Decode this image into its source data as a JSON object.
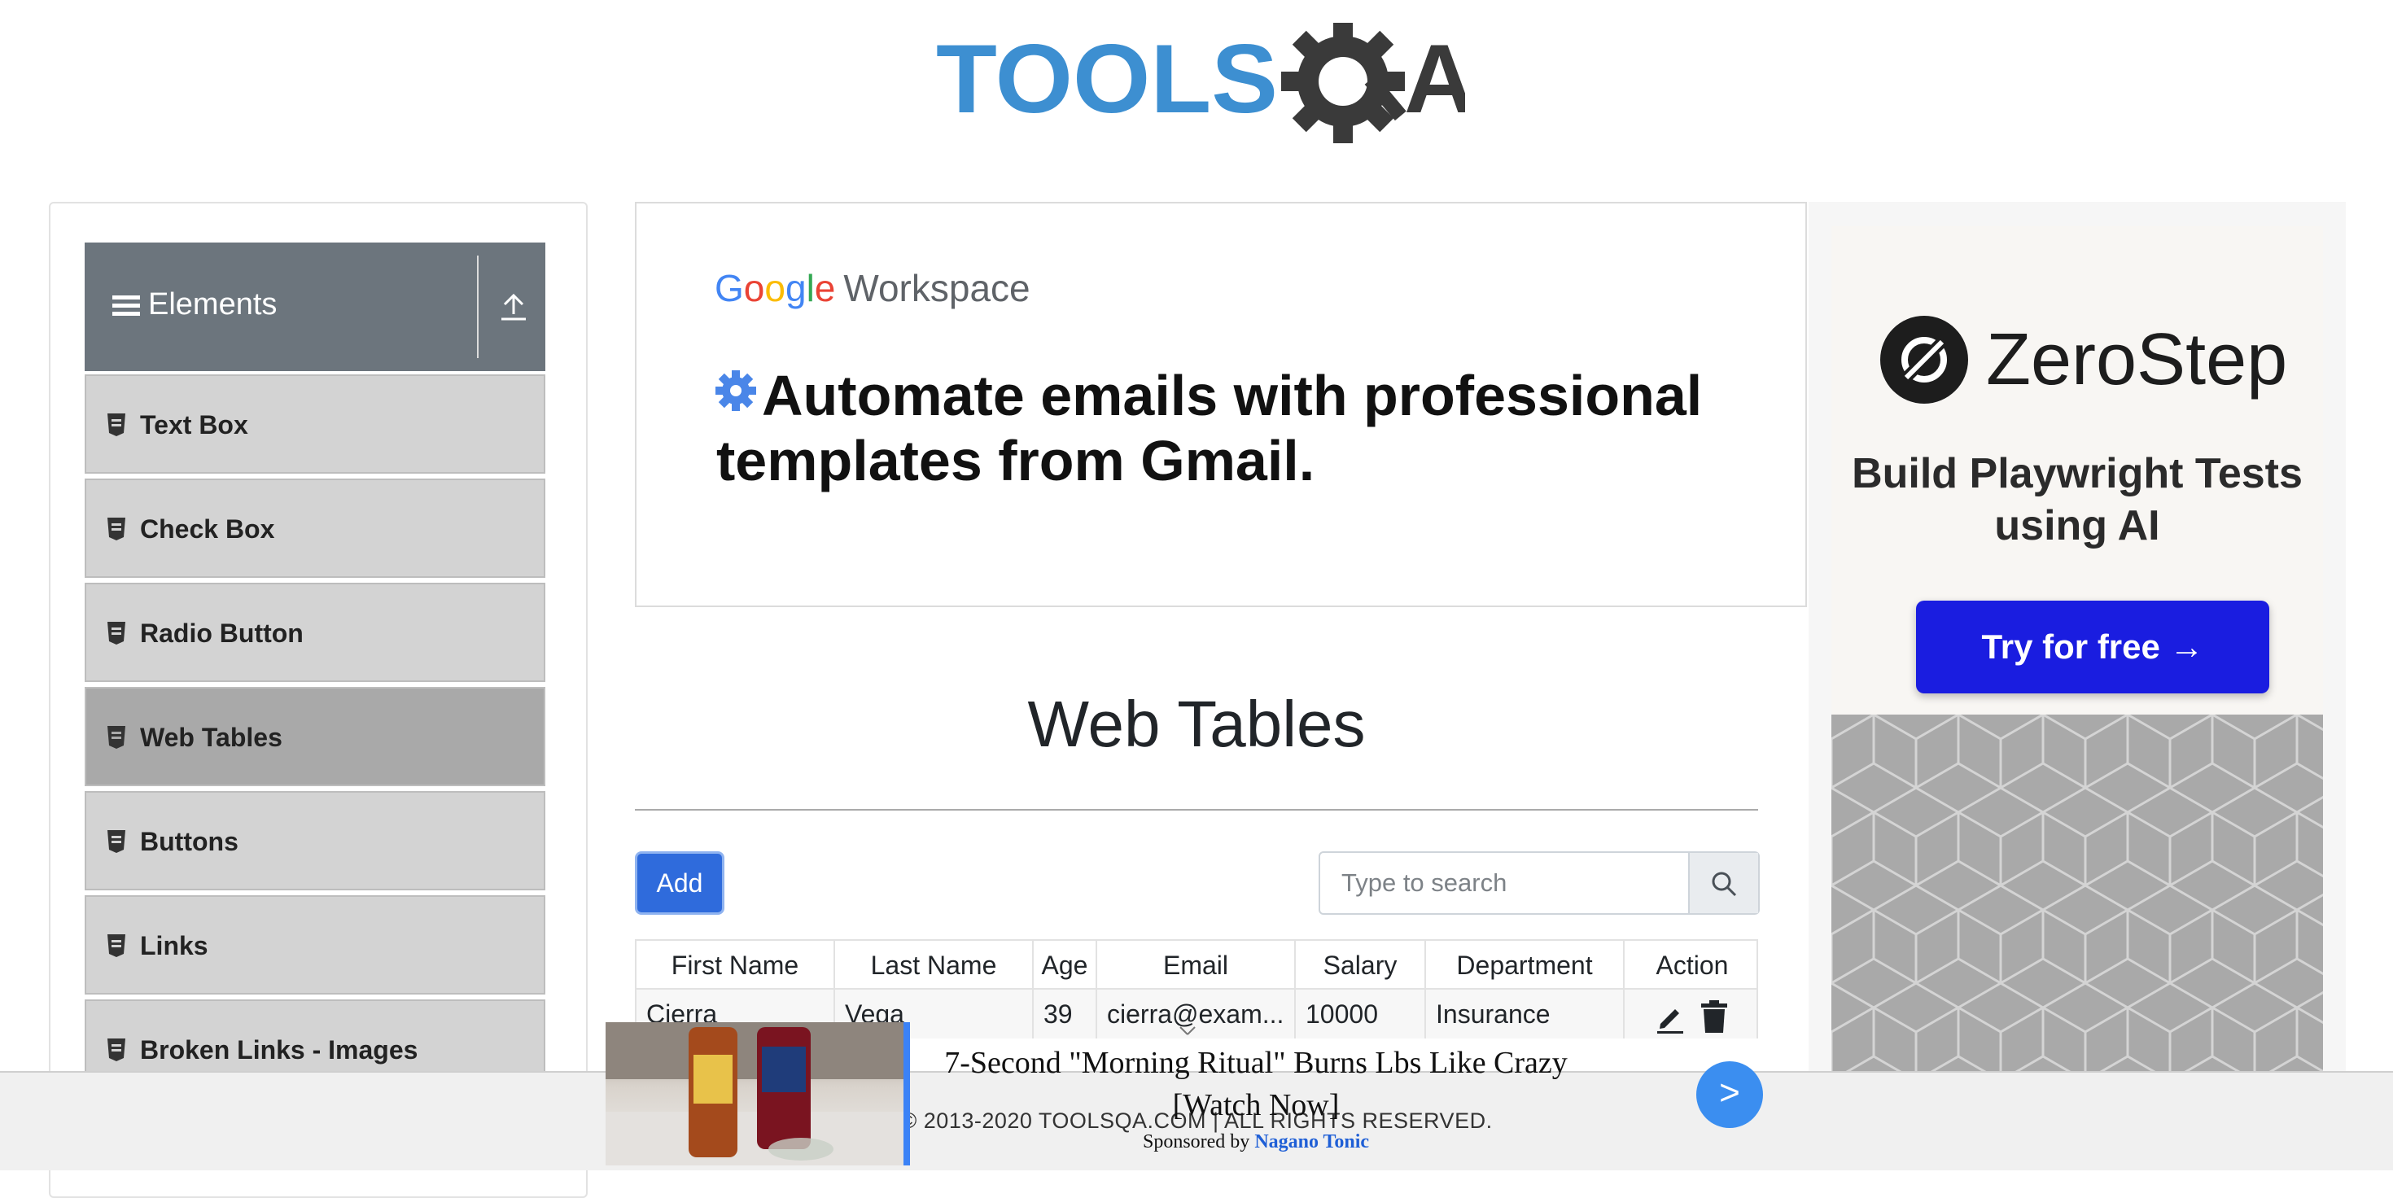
{
  "header": {
    "logo_alt": "TOOLSQA"
  },
  "sidebar": {
    "group_title": "Elements",
    "items": [
      {
        "label": "Text Box"
      },
      {
        "label": "Check Box"
      },
      {
        "label": "Radio Button"
      },
      {
        "label": "Web Tables",
        "active": true
      },
      {
        "label": "Buttons"
      },
      {
        "label": "Links"
      },
      {
        "label": "Broken Links - Images"
      }
    ]
  },
  "google_ad": {
    "brand_letters": [
      "G",
      "o",
      "o",
      "g",
      "l",
      "e"
    ],
    "product": "Workspace",
    "headline": "Automate emails with professional templates from Gmail."
  },
  "zerostep_ad": {
    "brand": "ZeroStep",
    "subtitle": "Build Playwright Tests using AI",
    "cta": "Try for free →"
  },
  "page": {
    "title": "Web Tables",
    "add_label": "Add",
    "search": {
      "placeholder": "Type to search",
      "value": ""
    }
  },
  "table": {
    "columns": [
      "First Name",
      "Last Name",
      "Age",
      "Email",
      "Salary",
      "Department",
      "Action"
    ],
    "rows": [
      {
        "first": "Cierra",
        "last": "Vega",
        "age": "39",
        "email": "cierra@exam...",
        "salary": "10000",
        "department": "Insurance"
      }
    ]
  },
  "footer": {
    "copyright": "© 2013-2020 TOOLSQA.COM | ALL RIGHTS RESERVED."
  },
  "bottom_ad": {
    "headline": "7-Second \"Morning Ritual\" Burns Lbs Like Crazy [Watch Now]",
    "sponsored_prefix": "Sponsored by",
    "sponsor": "Nagano Tonic",
    "next_glyph": ">"
  },
  "colors": {
    "sidebar_header": "#6c757d",
    "menu_item": "#d3d3d3",
    "menu_item_active": "#a9a9a9",
    "add_button": "#2f6bdc",
    "zerostep_cta": "#1a1de0",
    "logo_blue": "#3d8fd1",
    "logo_dark": "#3a3a3a"
  }
}
